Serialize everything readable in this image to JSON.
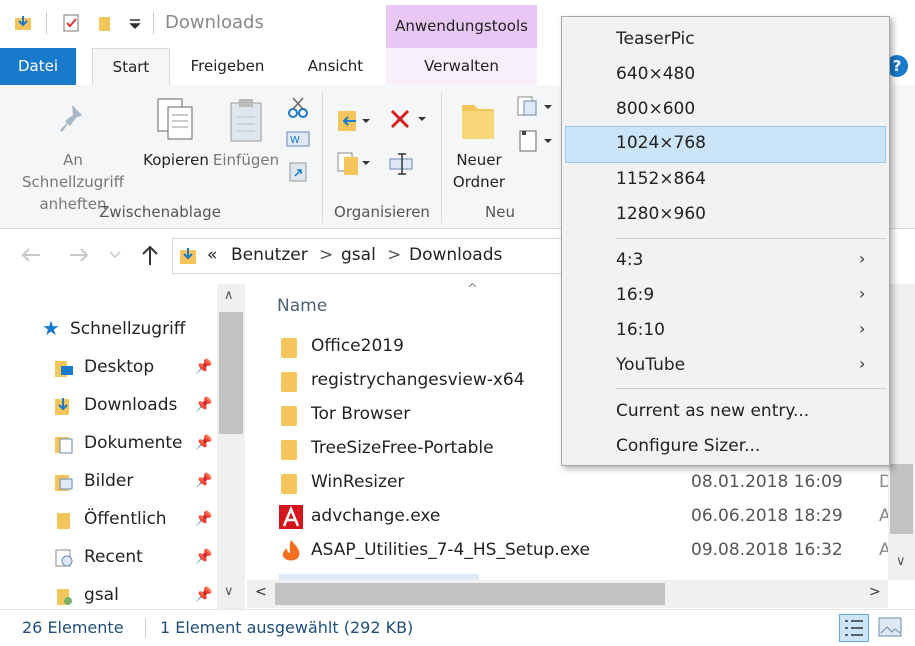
{
  "window": {
    "title": "Downloads"
  },
  "contextual_tab": {
    "group": "Anwendungstools",
    "tab": "Verwalten"
  },
  "tabs": [
    "Datei",
    "Start",
    "Freigeben",
    "Ansicht"
  ],
  "help_label": "?",
  "ribbon": {
    "pin_label_1": "An Schnellzugriff",
    "pin_label_2": "anheften",
    "copy_label": "Kopieren",
    "paste_label": "Einfügen",
    "new_folder_1": "Neuer",
    "new_folder_2": "Ordner",
    "groups": [
      "Zwischenablage",
      "Organisieren",
      "Neu"
    ]
  },
  "address": {
    "overflow": "«",
    "crumbs": [
      "Benutzer",
      "gsal",
      "Downloads"
    ]
  },
  "nav": {
    "header": "Schnellzugriff",
    "items": [
      "Desktop",
      "Downloads",
      "Dokumente",
      "Bilder",
      "Öffentlich",
      "Recent",
      "gsal"
    ]
  },
  "filelist": {
    "column_name": "Name",
    "rows": [
      {
        "name": "Office2019",
        "date": "",
        "ext": ""
      },
      {
        "name": "registrychangesview-x64",
        "date": "",
        "ext": ""
      },
      {
        "name": "Tor Browser",
        "date": "",
        "ext": ""
      },
      {
        "name": "TreeSizeFree-Portable",
        "date": "",
        "ext": ""
      },
      {
        "name": "WinResizer",
        "date": "08.01.2018 16:09",
        "ext": "D"
      },
      {
        "name": "advchange.exe",
        "date": "06.06.2018 18:29",
        "ext": "A"
      },
      {
        "name": "ASAP_Utilities_7-4_HS_Setup.exe",
        "date": "09.08.2018 16:32",
        "ext": "A"
      }
    ]
  },
  "status": {
    "count": "26 Elemente",
    "selection": "1 Element ausgewählt (292 KB)"
  },
  "menu": {
    "items": [
      {
        "label": "TeaserPic",
        "submenu": false,
        "selected": false
      },
      {
        "label": "640×480",
        "submenu": false,
        "selected": false
      },
      {
        "label": "800×600",
        "submenu": false,
        "selected": false
      },
      {
        "label": "1024×768",
        "submenu": false,
        "selected": true
      },
      {
        "label": "1152×864",
        "submenu": false,
        "selected": false
      },
      {
        "label": "1280×960",
        "submenu": false,
        "selected": false
      },
      {
        "label": "4:3",
        "submenu": true,
        "selected": false
      },
      {
        "label": "16:9",
        "submenu": true,
        "selected": false
      },
      {
        "label": "16:10",
        "submenu": true,
        "selected": false
      },
      {
        "label": "YouTube",
        "submenu": true,
        "selected": false
      },
      {
        "label": "Current as new entry...",
        "submenu": false,
        "selected": false
      },
      {
        "label": "Configure Sizer...",
        "submenu": false,
        "selected": false
      }
    ]
  },
  "colors": {
    "accent": "#1979ca",
    "contextual": "#e9c7f4",
    "folder": "#f3c55a",
    "selection": "#cce4f7"
  }
}
